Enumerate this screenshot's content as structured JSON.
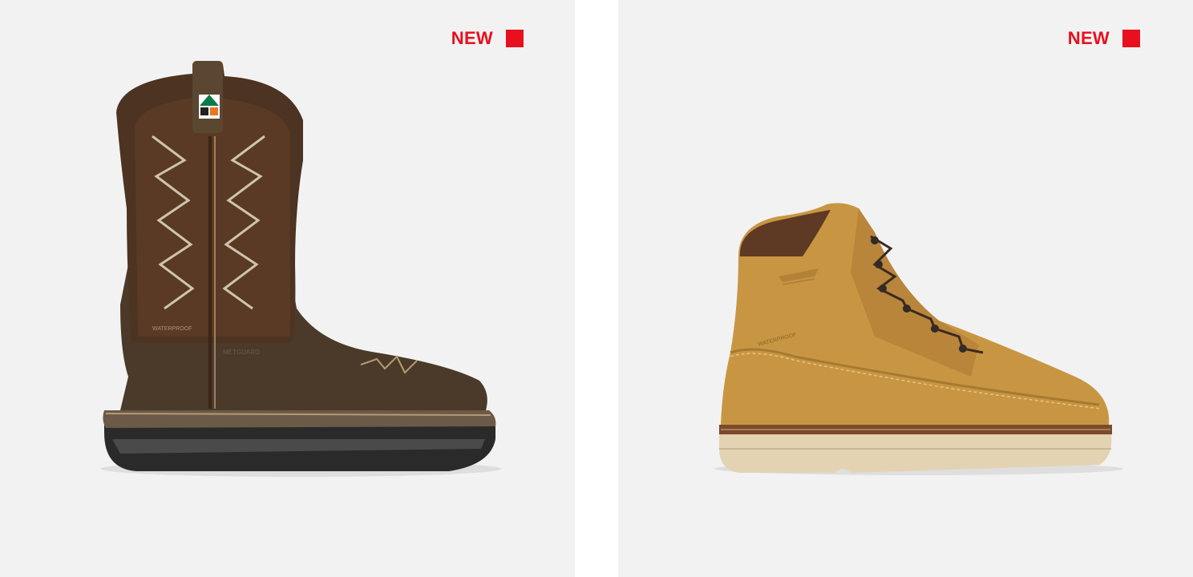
{
  "products": [
    {
      "badge": "NEW",
      "image_label": "Brown western pull-on waterproof work boot",
      "upper_text": "WATERPROOF",
      "shaft_text": "METGUARD",
      "colors": {
        "badge": "#e8101d",
        "background": "#f2f2f2"
      }
    },
    {
      "badge": "NEW",
      "image_label": "Wheat nubuck lace-up waterproof work boot",
      "upper_text": "WATERPROOF",
      "colors": {
        "badge": "#e8101d",
        "background": "#f2f2f2"
      }
    }
  ],
  "icons": [
    "new-badge-square-icon",
    "certification-tag-icon",
    "brand-logo-embossed"
  ]
}
